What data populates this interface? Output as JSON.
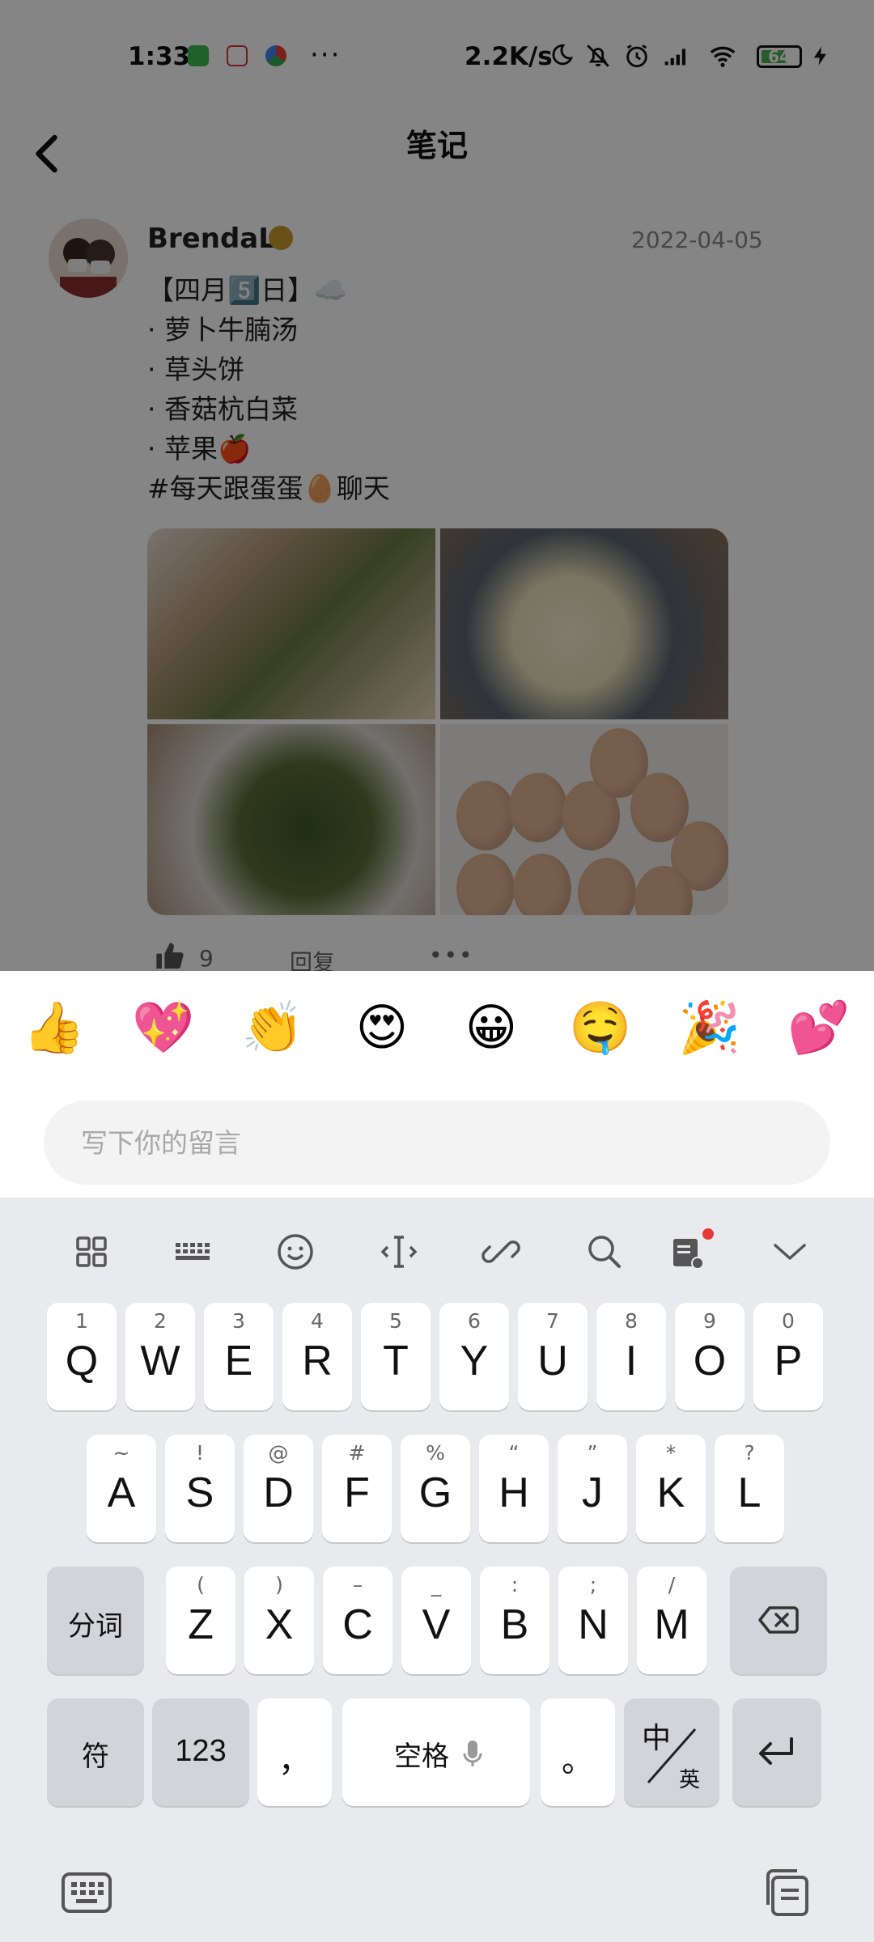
{
  "status_bar": {
    "time": "1:33",
    "more": "···",
    "net_speed": "2.2K/s",
    "battery": "64"
  },
  "header": {
    "title": "笔记"
  },
  "post": {
    "author": "BrendaL",
    "date": "2022-04-05",
    "lines": [
      "【四月5️⃣日】☁️",
      "· 萝卜牛腩汤",
      "· 草头饼",
      "· 香菇杭白菜",
      "· 苹果🍎",
      "#每天跟蛋蛋🥚聊天"
    ],
    "like_count": "9",
    "reply_label": "回复",
    "more_label": "•••"
  },
  "emoji_bar": [
    "👍",
    "💖",
    "👏",
    "😍",
    "😀",
    "🤤",
    "🎉",
    "💕"
  ],
  "comment": {
    "placeholder": "写下你的留言",
    "value": ""
  },
  "keyboard": {
    "toolbar": [
      "grid-icon",
      "keyboard-layout-icon",
      "emoji-icon",
      "cursor-icon",
      "clipboard-link-icon",
      "search-icon",
      "note-icon",
      "collapse-icon"
    ],
    "row1": [
      {
        "main": "Q",
        "sub": "1"
      },
      {
        "main": "W",
        "sub": "2"
      },
      {
        "main": "E",
        "sub": "3"
      },
      {
        "main": "R",
        "sub": "4"
      },
      {
        "main": "T",
        "sub": "5"
      },
      {
        "main": "Y",
        "sub": "6"
      },
      {
        "main": "U",
        "sub": "7"
      },
      {
        "main": "I",
        "sub": "8"
      },
      {
        "main": "O",
        "sub": "9"
      },
      {
        "main": "P",
        "sub": "0"
      }
    ],
    "row2": [
      {
        "main": "A",
        "sub": "~"
      },
      {
        "main": "S",
        "sub": "!"
      },
      {
        "main": "D",
        "sub": "@"
      },
      {
        "main": "F",
        "sub": "#"
      },
      {
        "main": "G",
        "sub": "%"
      },
      {
        "main": "H",
        "sub": "“"
      },
      {
        "main": "J",
        "sub": "”"
      },
      {
        "main": "K",
        "sub": "*"
      },
      {
        "main": "L",
        "sub": "?"
      }
    ],
    "row3": [
      {
        "main": "Z",
        "sub": "("
      },
      {
        "main": "X",
        "sub": ")"
      },
      {
        "main": "C",
        "sub": "–"
      },
      {
        "main": "V",
        "sub": "_"
      },
      {
        "main": "B",
        "sub": ":"
      },
      {
        "main": "N",
        "sub": ";"
      },
      {
        "main": "M",
        "sub": "/"
      }
    ],
    "segment_label": "分词",
    "symbol_label": "符",
    "numbers_label": "123",
    "comma": "，",
    "space_label": "空格",
    "period": "。",
    "lang_top": "中",
    "lang_bottom": "英"
  }
}
